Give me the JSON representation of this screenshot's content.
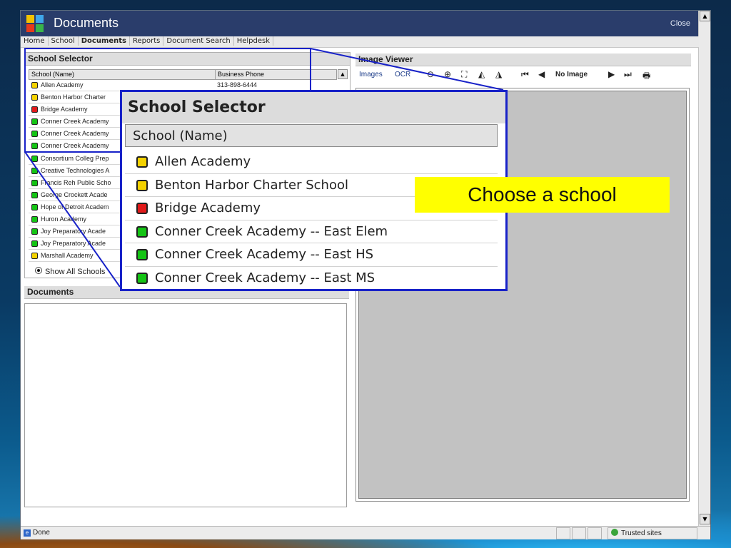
{
  "window": {
    "title": "Documents",
    "close_label": "Close"
  },
  "menu": {
    "items": [
      {
        "label": "Home",
        "active": false
      },
      {
        "label": "School",
        "active": false
      },
      {
        "label": "Documents",
        "active": true
      },
      {
        "label": "Reports",
        "active": false
      },
      {
        "label": "Document Search",
        "active": false
      },
      {
        "label": "Helpdesk",
        "active": false
      }
    ]
  },
  "school_selector": {
    "title": "School Selector",
    "col_name": "School (Name)",
    "col_phone": "Business Phone",
    "rows": [
      {
        "name": "Allen Academy",
        "phone": "313-898-6444",
        "status": "yellow"
      },
      {
        "name": "Benton Harbor Charter",
        "phone": "",
        "status": "yellow"
      },
      {
        "name": "Bridge Academy",
        "phone": "",
        "status": "red"
      },
      {
        "name": "Conner Creek Academy",
        "phone": "",
        "status": "green"
      },
      {
        "name": "Conner Creek Academy",
        "phone": "",
        "status": "green"
      },
      {
        "name": "Conner Creek Academy",
        "phone": "",
        "status": "green"
      },
      {
        "name": "Consortium Colleg Prep",
        "phone": "",
        "status": "green"
      },
      {
        "name": "Creative Technologies A",
        "phone": "",
        "status": "green"
      },
      {
        "name": "Francis Reh Public Scho",
        "phone": "",
        "status": "green"
      },
      {
        "name": "George Crockett Acade",
        "phone": "",
        "status": "green"
      },
      {
        "name": "Hope of Detroit Academ",
        "phone": "",
        "status": "green"
      },
      {
        "name": "Huron Academy",
        "phone": "",
        "status": "green"
      },
      {
        "name": "Joy Preparatory Acade",
        "phone": "",
        "status": "green"
      },
      {
        "name": "Joy Preparatory Acade",
        "phone": "",
        "status": "green"
      },
      {
        "name": "Marshall Academy",
        "phone": "",
        "status": "yellow"
      }
    ],
    "show_all_label": "Show All Schools"
  },
  "documents": {
    "title": "Documents"
  },
  "image_viewer": {
    "title": "Image Viewer",
    "images_label": "Images",
    "ocr_label": "OCR",
    "no_image_label": "No Image",
    "icons": [
      "zoom-out-icon",
      "zoom-in-icon",
      "fit-icon",
      "rotate-left-icon",
      "rotate-right-icon",
      "first-icon",
      "prev-icon",
      "next-icon",
      "last-icon",
      "print-icon"
    ]
  },
  "status_bar": {
    "done_label": "Done",
    "zone_label": "Trusted sites"
  },
  "zoom": {
    "title": "School Selector",
    "col_name": "School (Name)",
    "rows": [
      {
        "name": "Allen Academy",
        "status": "yellow"
      },
      {
        "name": "Benton Harbor Charter School",
        "status": "yellow"
      },
      {
        "name": "Bridge Academy",
        "status": "red"
      },
      {
        "name": "Conner Creek Academy -- East Elem",
        "status": "green"
      },
      {
        "name": "Conner Creek Academy -- East HS",
        "status": "green"
      },
      {
        "name": "Conner Creek Academy -- East MS",
        "status": "green"
      }
    ]
  },
  "callout": {
    "text": "Choose a school"
  },
  "colors": {
    "yellow": "#f4d200",
    "red": "#e11a1a",
    "green": "#14c414",
    "highlight_border": "#1822c8",
    "callout_bg": "#ffff00"
  }
}
